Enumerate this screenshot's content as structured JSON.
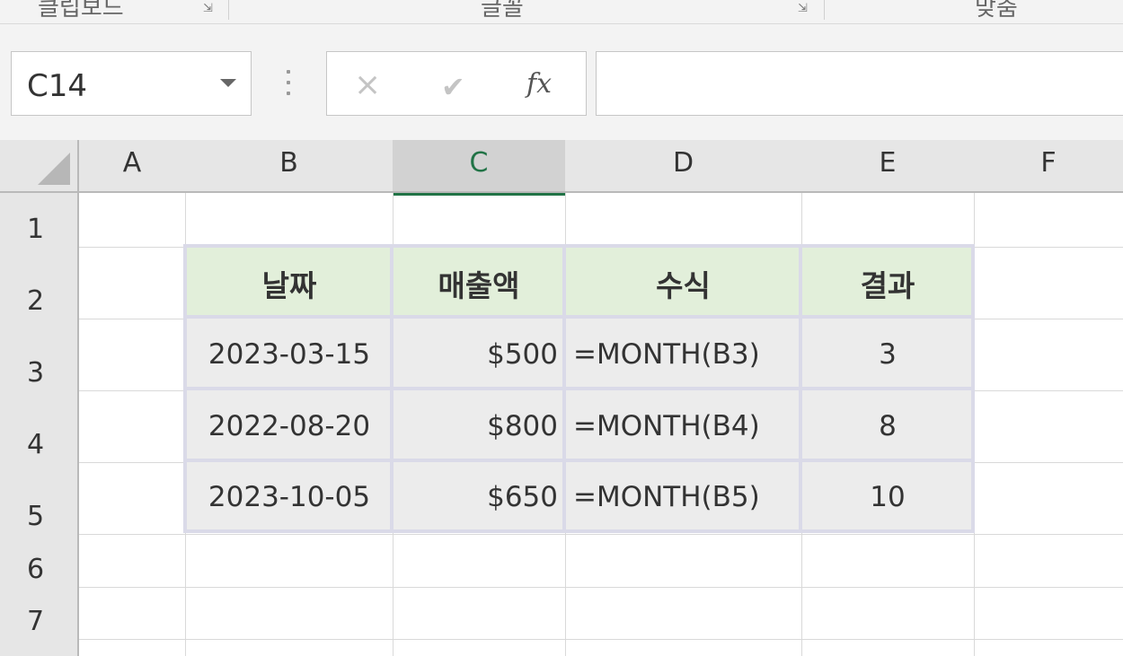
{
  "ribbon": {
    "groups": [
      {
        "label": "클립보드"
      },
      {
        "label": "글꼴"
      },
      {
        "label": "맞춤"
      }
    ]
  },
  "formula_bar": {
    "name_box": "C14",
    "cancel_icon": "×",
    "enter_icon": "✔",
    "fx_label": "fx",
    "formula": ""
  },
  "sheet": {
    "columns": [
      "A",
      "B",
      "C",
      "D",
      "E",
      "F"
    ],
    "selected_column": "C",
    "rows": [
      "1",
      "2",
      "3",
      "4",
      "5",
      "6",
      "7"
    ],
    "table": {
      "headers": [
        "날짜",
        "매출액",
        "수식",
        "결과"
      ],
      "rows": [
        [
          "2023-03-15",
          "$500",
          "=MONTH(B3)",
          "3"
        ],
        [
          "2022-08-20",
          "$800",
          "=MONTH(B4)",
          "8"
        ],
        [
          "2023-10-05",
          "$650",
          "=MONTH(B5)",
          "10"
        ]
      ]
    },
    "colors": {
      "header_fill": "#e2efda",
      "data_fill": "#ececec",
      "selection_accent": "#217346"
    }
  }
}
